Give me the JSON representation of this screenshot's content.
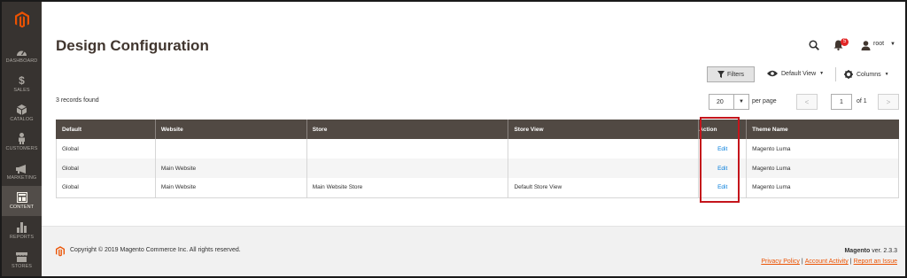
{
  "sidebar": {
    "logo": "magento-logo",
    "items": [
      {
        "label": "DASHBOARD",
        "icon": "dashboard-icon"
      },
      {
        "label": "SALES",
        "icon": "dollar-icon"
      },
      {
        "label": "CATALOG",
        "icon": "cube-icon"
      },
      {
        "label": "CUSTOMERS",
        "icon": "person-icon"
      },
      {
        "label": "MARKETING",
        "icon": "megaphone-icon"
      },
      {
        "label": "CONTENT",
        "icon": "layout-icon",
        "active": true
      },
      {
        "label": "REPORTS",
        "icon": "bar-chart-icon"
      },
      {
        "label": "STORES",
        "icon": "store-icon"
      }
    ]
  },
  "header": {
    "title": "Design Configuration",
    "notifications_count": "5",
    "user": "root"
  },
  "toolbar": {
    "filters_label": "Filters",
    "view_label": "Default View",
    "columns_label": "Columns"
  },
  "pager": {
    "records_found": "3 records found",
    "per_page_value": "20",
    "per_page_label": "per page",
    "current_page": "1",
    "of_pages": "of 1"
  },
  "grid": {
    "columns": [
      "Default",
      "Website",
      "Store",
      "Store View",
      "Action",
      "Theme Name"
    ],
    "rows": [
      {
        "default": "Global",
        "website": "",
        "store": "",
        "store_view": "",
        "action": "Edit",
        "theme": "Magento Luma"
      },
      {
        "default": "Global",
        "website": "Main Website",
        "store": "",
        "store_view": "",
        "action": "Edit",
        "theme": "Magento Luma"
      },
      {
        "default": "Global",
        "website": "Main Website",
        "store": "Main Website Store",
        "store_view": "Default Store View",
        "action": "Edit",
        "theme": "Magento Luma"
      }
    ]
  },
  "footer": {
    "copyright": "Copyright © 2019 Magento Commerce Inc. All rights reserved.",
    "brand": "Magento",
    "version": " ver. 2.3.3",
    "links": [
      "Privacy Policy",
      "Account Activity",
      "Report an Issue"
    ],
    "link_separator": "|"
  },
  "colors": {
    "sidebar_bg": "#373330",
    "table_header_bg": "#514943",
    "accent_orange": "#eb5202",
    "link_blue": "#007bdb",
    "highlight_red": "#c4151c",
    "badge_red": "#e22626"
  }
}
